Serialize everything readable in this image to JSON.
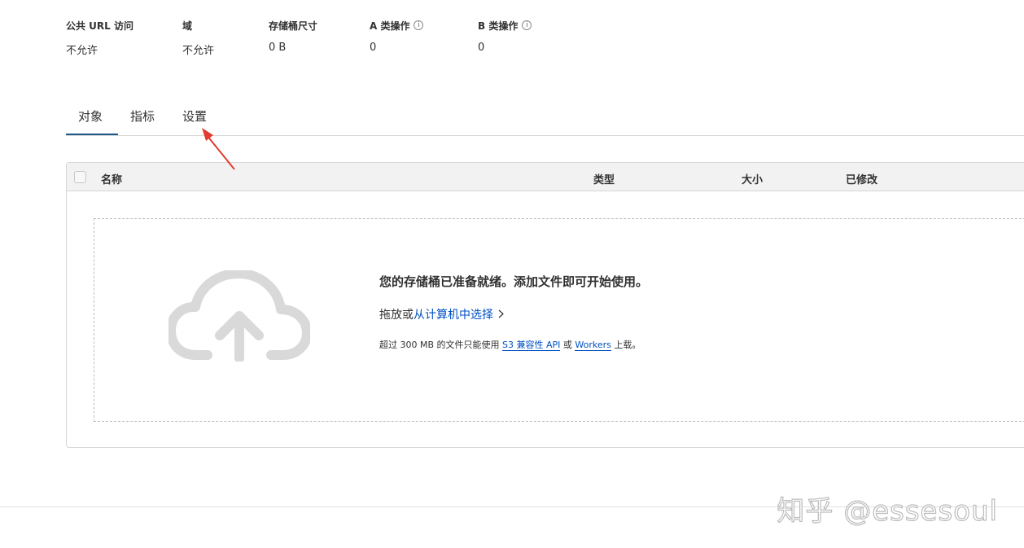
{
  "stats": [
    {
      "label": "公共 URL 访问",
      "value": "不允许",
      "info": false
    },
    {
      "label": "域",
      "value": "不允许",
      "info": false
    },
    {
      "label": "存储桶尺寸",
      "value": "0 B",
      "info": false
    },
    {
      "label": "A 类操作",
      "value": "0",
      "info": true
    },
    {
      "label": "B 类操作",
      "value": "0",
      "info": true
    }
  ],
  "info_icon": "info-circle-icon",
  "tabs": [
    {
      "label": "对象",
      "active": true
    },
    {
      "label": "指标",
      "active": false
    },
    {
      "label": "设置",
      "active": false
    }
  ],
  "accent_color": "#1d5a8a",
  "link_color": "#0051c3",
  "annotation_color": "#e03c31",
  "table": {
    "columns": [
      "名称",
      "类型",
      "大小",
      "已修改"
    ]
  },
  "empty_state": {
    "icon": "cloud-upload-icon",
    "title": "您的存储桶已准备就绪。添加文件即可开始使用。",
    "drop_prefix": "拖放或",
    "select_link": "从计算机中选择",
    "note_prefix": "超过 300 MB 的文件只能使用",
    "note_link1": "S3 兼容性 API",
    "note_or": "或",
    "note_link2": "Workers",
    "note_suffix": "上载。"
  },
  "watermark": "知乎 @essesoul"
}
